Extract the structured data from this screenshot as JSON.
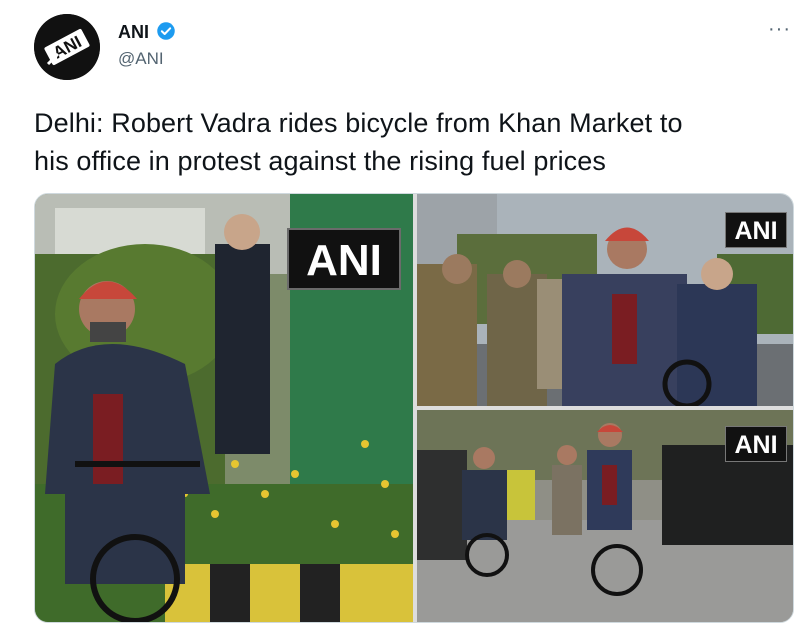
{
  "tweet": {
    "author_name": "ANI",
    "handle": "@ANI",
    "avatar_text": "ANI",
    "more_label": "···",
    "text_line1": "Delhi: Robert Vadra rides bicycle from Khan Market to",
    "text_line2": "his office in protest against the rising fuel prices"
  },
  "media": {
    "watermarks": [
      "ANI",
      "ANI",
      "ANI"
    ]
  },
  "colors": {
    "verified": "#1d9bf0",
    "handle": "#536471",
    "text": "#0f1419"
  },
  "icons": {
    "verified": "verified-badge-icon",
    "more": "more-options-icon"
  }
}
